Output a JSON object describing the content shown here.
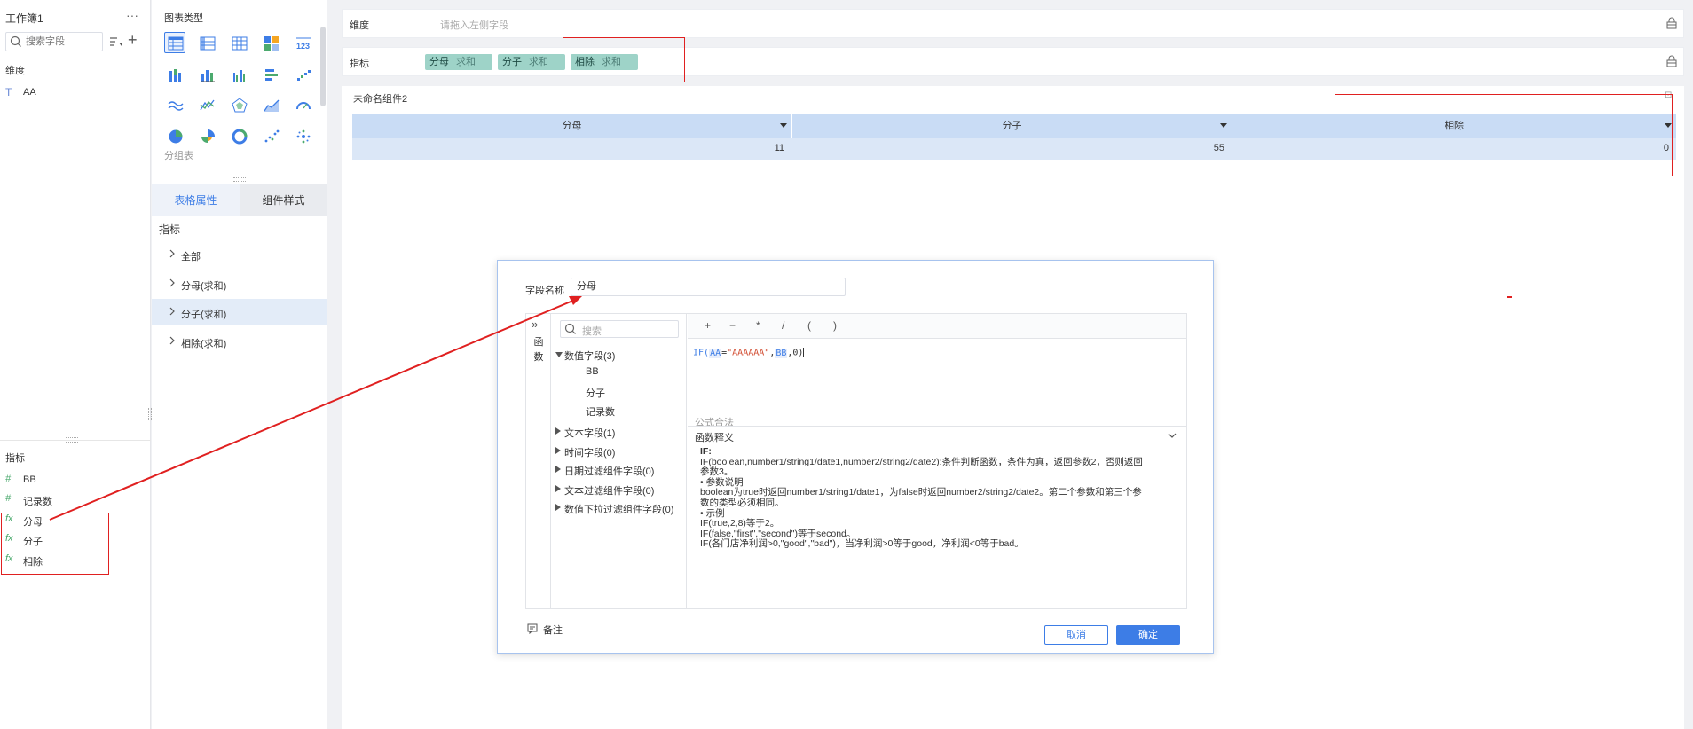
{
  "left_panel": {
    "workbook_title": "工作簿1",
    "more_icon": "more-horizontal-icon",
    "search_placeholder": "搜索字段",
    "dimension_label": "维度",
    "dimensions": [
      {
        "type": "T",
        "label": "AA"
      }
    ],
    "measure_label": "指标",
    "measures": [
      {
        "type": "#",
        "label": "BB"
      },
      {
        "type": "#",
        "label": "记录数"
      },
      {
        "type": "fx",
        "label": "分母"
      },
      {
        "type": "fx",
        "label": "分子"
      },
      {
        "type": "fx",
        "label": "相除"
      }
    ]
  },
  "middle_panel": {
    "chart_type_label": "图表类型",
    "chart_hint": "分组表",
    "tabs": [
      "表格属性",
      "组件样式"
    ],
    "metrics_label": "指标",
    "tree": [
      "全部",
      "分母(求和)",
      "分子(求和)",
      "相除(求和)"
    ],
    "selected_tree_index": 2
  },
  "shelves": {
    "dimension_label": "维度",
    "dimension_placeholder": "请拖入左侧字段",
    "measure_label": "指标",
    "pills": [
      {
        "name": "分母",
        "agg": "求和"
      },
      {
        "name": "分子",
        "agg": "求和"
      },
      {
        "name": "相除",
        "agg": "求和"
      }
    ]
  },
  "component": {
    "title": "未命名组件2",
    "columns": [
      "分母",
      "分子",
      "相除"
    ],
    "row": [
      "11",
      "55",
      "0"
    ]
  },
  "dialog": {
    "field_name_label": "字段名称",
    "field_name_value": "分母",
    "rail_expand": "»",
    "rail_label": "函数",
    "search_placeholder": "搜索",
    "field_groups": [
      {
        "label": "数值字段(3)",
        "expanded": true,
        "children": [
          "BB",
          "分子",
          "记录数"
        ]
      },
      {
        "label": "文本字段(1)",
        "expanded": false
      },
      {
        "label": "时间字段(0)",
        "expanded": false
      },
      {
        "label": "日期过滤组件字段(0)",
        "expanded": false
      },
      {
        "label": "文本过滤组件字段(0)",
        "expanded": false
      },
      {
        "label": "数值下拉过滤组件字段(0)",
        "expanded": false
      }
    ],
    "operators": [
      "+",
      "−",
      "*",
      "/",
      "(",
      ")"
    ],
    "formula": {
      "fn": "IF(",
      "field1": "AA",
      "eq": "=",
      "str": "\"AAAAAA\"",
      "comma1": ",",
      "field2": "BB",
      "rest": ",0)"
    },
    "validity": "公式合法",
    "explain_title": "函数释义",
    "help_lines": [
      "IF:",
      "IF(boolean,number1/string1/date1,number2/string2/date2):条件判断函数，条件为真，返回参数2，否则返回",
      "参数3。",
      "• 参数说明",
      "boolean为true时返回number1/string1/date1，为false时返回number2/string2/date2。第二个参数和第三个参",
      "数的类型必须相同。",
      "• 示例",
      "IF(true,2,8)等于2。",
      "IF(false,\"first\",\"second\")等于second。",
      "IF(各门店净利润>0,\"good\",\"bad\")，当净利润>0等于good，净利润<0等于bad。"
    ],
    "note_label": "备注",
    "cancel_label": "取消",
    "ok_label": "确定"
  },
  "colors": {
    "accent": "#3d7de6",
    "pill": "#9ed3c8",
    "header": "#c9dcf5",
    "annotation": "#e02020"
  }
}
